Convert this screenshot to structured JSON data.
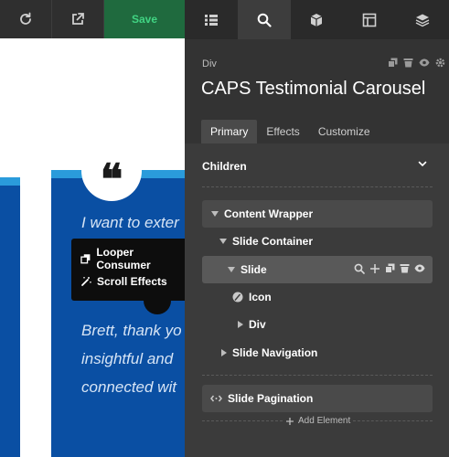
{
  "toolbar": {
    "save_label": "Save",
    "icons": [
      "refresh-icon",
      "external-link-icon"
    ]
  },
  "panel_tabs": [
    "list-icon",
    "search-icon",
    "cube-icon",
    "layout-icon",
    "layers-icon"
  ],
  "inspector": {
    "element_type": "Div",
    "element_title": "CAPS Testimonial Carousel",
    "actions": [
      "copy-icon",
      "trash-icon",
      "eye-icon",
      "gear-icon"
    ],
    "subtabs": [
      "Primary",
      "Effects",
      "Customize"
    ],
    "active_subtab": "Primary",
    "children_label": "Children",
    "add_element_label": "Add Element"
  },
  "tree": [
    {
      "label": "Content Wrapper",
      "level": 0,
      "expanded": true
    },
    {
      "label": "Slide Container",
      "level": 1,
      "expanded": true
    },
    {
      "label": "Slide",
      "level": 2,
      "expanded": true,
      "selected": true
    },
    {
      "label": "Icon",
      "level": 3
    },
    {
      "label": "Div",
      "level": 3,
      "expanded": false
    },
    {
      "label": "Slide Navigation",
      "level": 1,
      "expanded": false
    },
    {
      "label": "Slide Pagination",
      "level": 0
    }
  ],
  "context_menu": [
    "Looper Consumer",
    "Scroll Effects"
  ],
  "canvas": {
    "testimonial_lines": [
      "I want to exter",
      "Brett, thank yo",
      "insightful and",
      "connected wit"
    ],
    "quote_glyph": "❝"
  },
  "colors": {
    "panel_bg": "#333333",
    "save_green": "#41d483",
    "card_blue": "#0a4fa3",
    "card_accent": "#2a9bdb"
  }
}
